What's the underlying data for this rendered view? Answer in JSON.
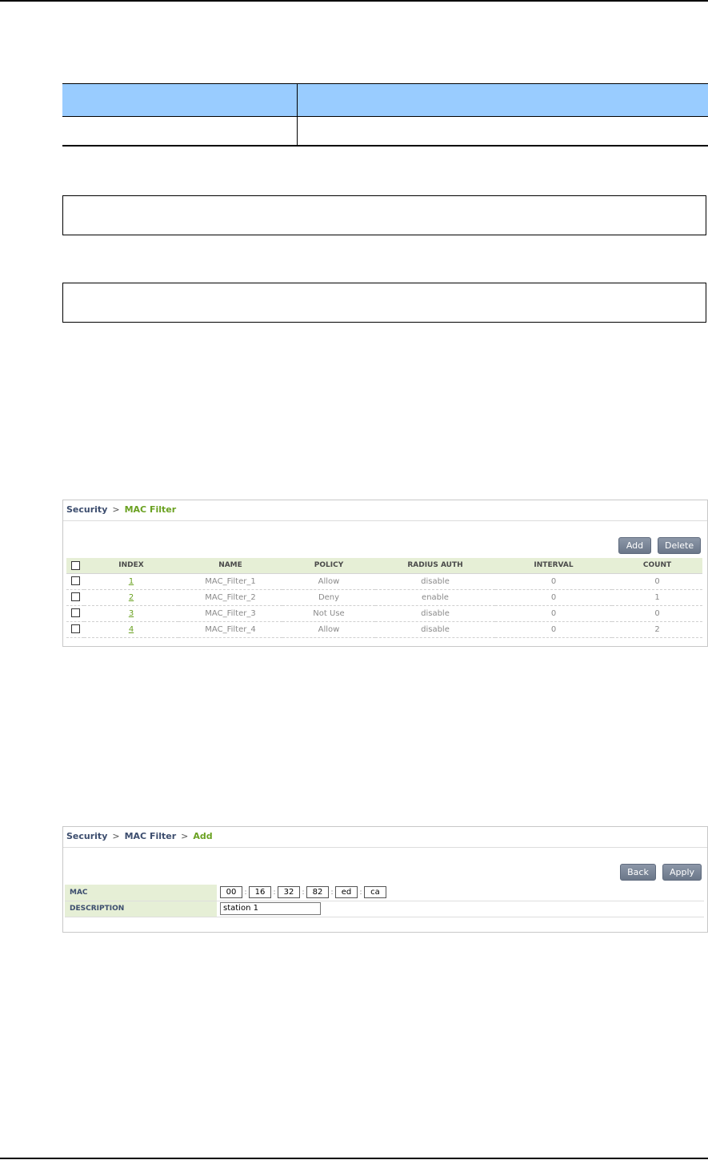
{
  "mac_filter_list": {
    "breadcrumb": {
      "root": "Security",
      "current": "MAC Filter"
    },
    "buttons": {
      "add": "Add",
      "delete": "Delete"
    },
    "columns": [
      "INDEX",
      "NAME",
      "POLICY",
      "RADIUS AUTH",
      "INTERVAL",
      "COUNT"
    ],
    "rows": [
      {
        "index": "1",
        "name": "MAC_Filter_1",
        "policy": "Allow",
        "radius_auth": "disable",
        "interval": "0",
        "count": "0"
      },
      {
        "index": "2",
        "name": "MAC_Filter_2",
        "policy": "Deny",
        "radius_auth": "enable",
        "interval": "0",
        "count": "1"
      },
      {
        "index": "3",
        "name": "MAC_Filter_3",
        "policy": "Not Use",
        "radius_auth": "disable",
        "interval": "0",
        "count": "0"
      },
      {
        "index": "4",
        "name": "MAC_Filter_4",
        "policy": "Allow",
        "radius_auth": "disable",
        "interval": "0",
        "count": "2"
      }
    ]
  },
  "mac_filter_add": {
    "breadcrumb": {
      "root": "Security",
      "middle": "MAC Filter",
      "current": "Add"
    },
    "buttons": {
      "back": "Back",
      "apply": "Apply"
    },
    "fields": {
      "mac_label": "MAC",
      "mac_octets": [
        "00",
        "16",
        "32",
        "82",
        "ed",
        "ca"
      ],
      "mac_separator": ":",
      "description_label": "DESCRIPTION",
      "description_value": "station 1"
    }
  },
  "colors": {
    "header_blue": "#99ccff",
    "breadcrumb_green": "#6aa121",
    "grid_header": "#e6efd6",
    "button": "#7a8597"
  }
}
